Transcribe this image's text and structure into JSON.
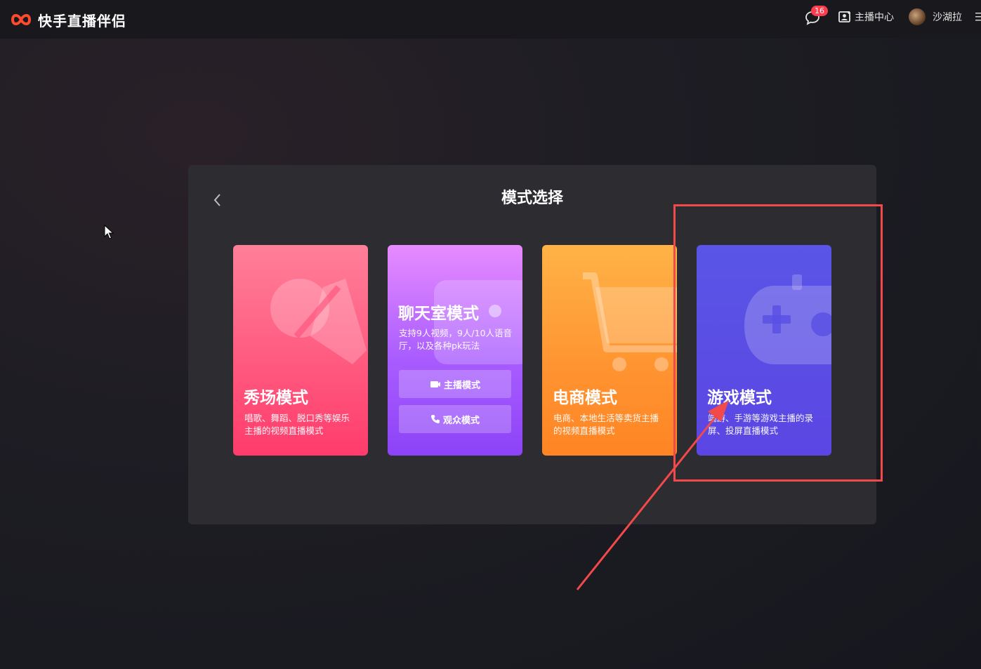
{
  "app": {
    "title": "快手直播伴侣"
  },
  "header": {
    "message_count": "16",
    "anchor_center_label": "主播中心",
    "username": "沙湖拉"
  },
  "dialog": {
    "title": "模式选择",
    "cards": [
      {
        "name": "秀场模式",
        "desc": "唱歌、舞蹈、脱口秀等娱乐主播的视频直播模式",
        "icon": "lollipop-icon"
      },
      {
        "name": "聊天室模式",
        "desc": "支持9人视频，9人/10人语音厅，以及各种pk玩法",
        "icon": "chat-bubble-icon",
        "buttons": [
          {
            "label": "主播模式",
            "icon": "camera-icon"
          },
          {
            "label": "观众模式",
            "icon": "phone-icon"
          }
        ]
      },
      {
        "name": "电商模式",
        "desc": "电商、本地生活等卖货主播的视频直播模式",
        "icon": "shopping-cart-icon"
      },
      {
        "name": "游戏模式",
        "desc": "端游、手游等游戏主播的录屏、投屏直播模式",
        "icon": "gamepad-icon"
      }
    ]
  },
  "colors": {
    "show_card": "#ff4d77",
    "chat_card": "#b264ff",
    "shop_card": "#ff9a33",
    "game_card": "#5a4fe5",
    "annotation": "#f24a4a",
    "badge": "#ff3b4e"
  }
}
